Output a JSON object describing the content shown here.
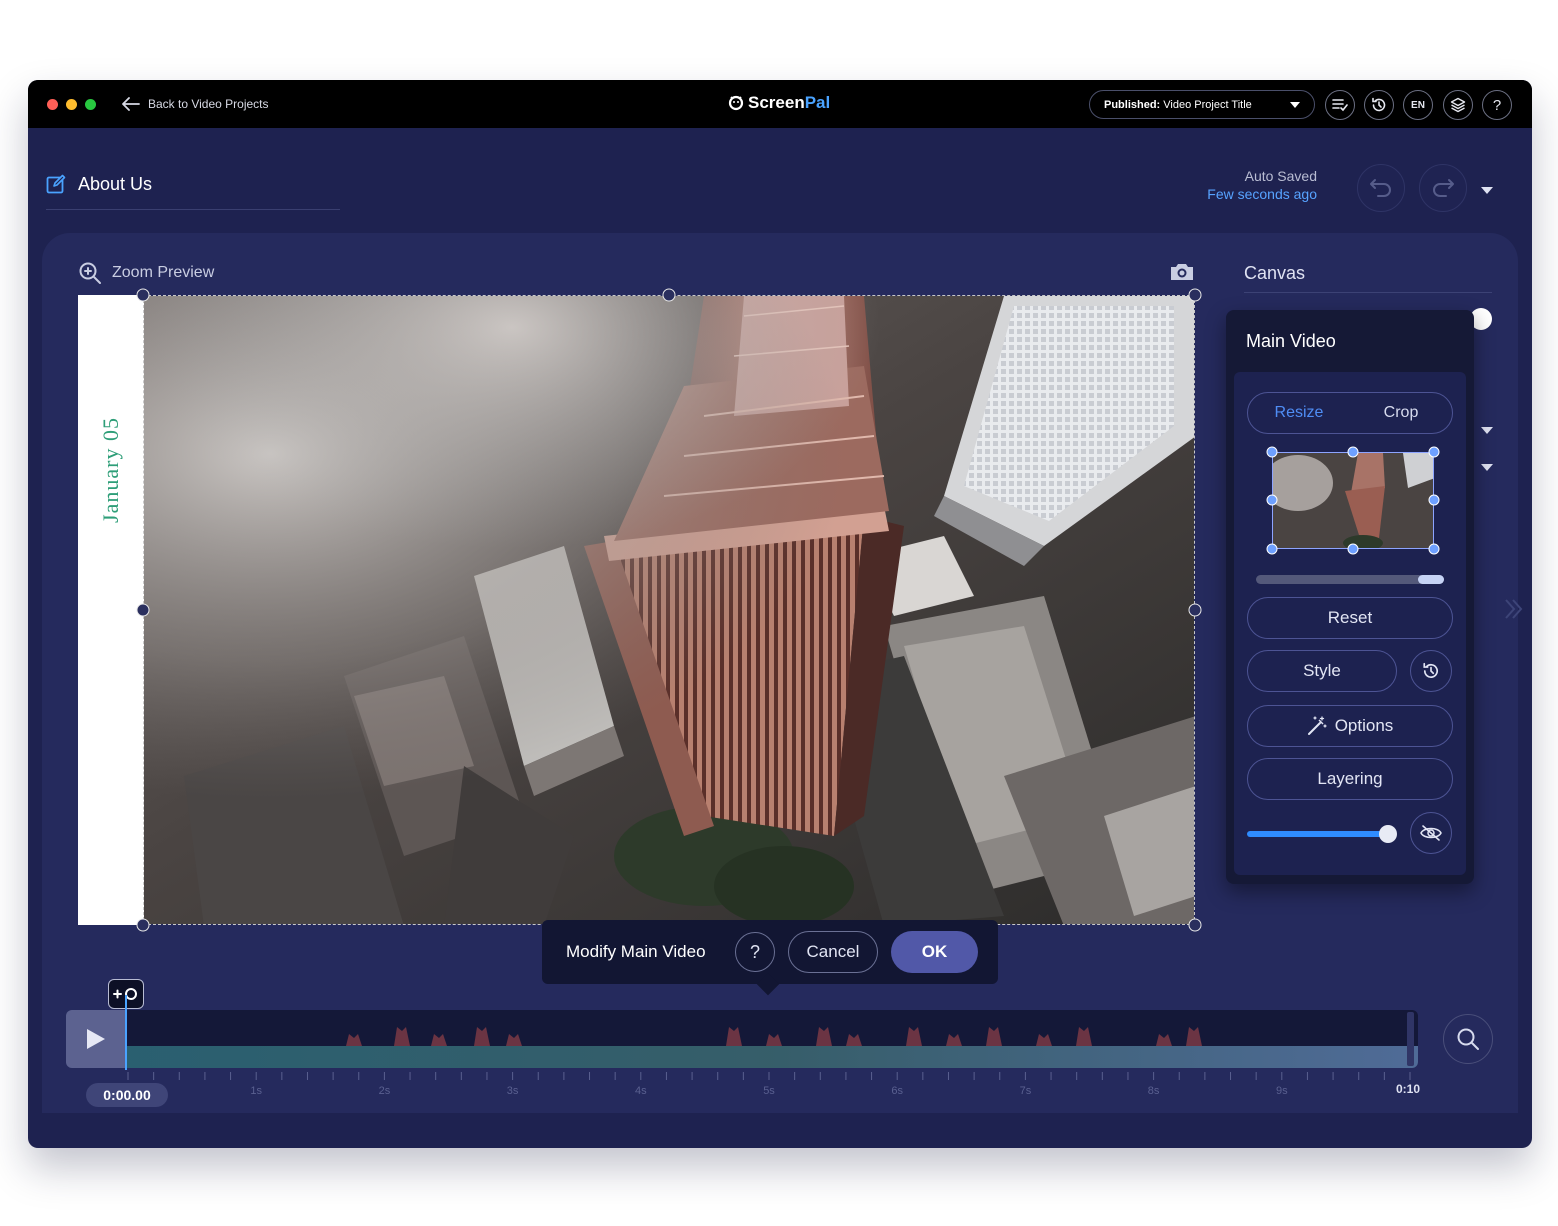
{
  "titlebar": {
    "back_label": "Back to Video Projects",
    "logo_screen": "Screen",
    "logo_pal": "Pal",
    "publish_status": "Published:",
    "publish_title": "Video Project Title",
    "lang": "EN",
    "help": "?"
  },
  "project": {
    "title": "About Us",
    "saved_label": "Auto Saved",
    "saved_time": "Few seconds ago"
  },
  "preview": {
    "zoom_label": "Zoom Preview",
    "overlay_text": "January 05"
  },
  "right_panel": {
    "title": "Canvas"
  },
  "popup": {
    "title": "Main Video",
    "tabs": [
      {
        "label": "Resize",
        "active": true
      },
      {
        "label": "Crop",
        "active": false
      }
    ],
    "crop_zoom_level": 0.95,
    "reset_label": "Reset",
    "style_label": "Style",
    "options_label": "Options",
    "layering_label": "Layering",
    "opacity_level": 1.0
  },
  "modify_bar": {
    "label": "Modify Main Video",
    "help": "?",
    "cancel_label": "Cancel",
    "ok_label": "OK"
  },
  "timeline": {
    "current_time": "0:00.00",
    "end_time": "0:10",
    "second_labels": [
      "1s",
      "2s",
      "3s",
      "4s",
      "5s",
      "6s",
      "7s",
      "8s",
      "9s"
    ]
  },
  "colors": {
    "accent": "#4f8df5",
    "brand_blue": "#4aa3ff",
    "saved_text": "#57a3ff",
    "ok_button": "#5158a8",
    "overlay_text": "#2e9e78"
  },
  "icons": [
    "back-arrow-icon",
    "chevron-down-icon",
    "checklist-icon",
    "history-icon",
    "layers-icon",
    "help-icon",
    "edit-icon",
    "undo-icon",
    "redo-icon",
    "zoom-in-icon",
    "camera-icon",
    "magic-wand-icon",
    "eye-off-icon",
    "play-icon",
    "add-marker-icon",
    "search-icon",
    "double-chevron-right-icon"
  ]
}
